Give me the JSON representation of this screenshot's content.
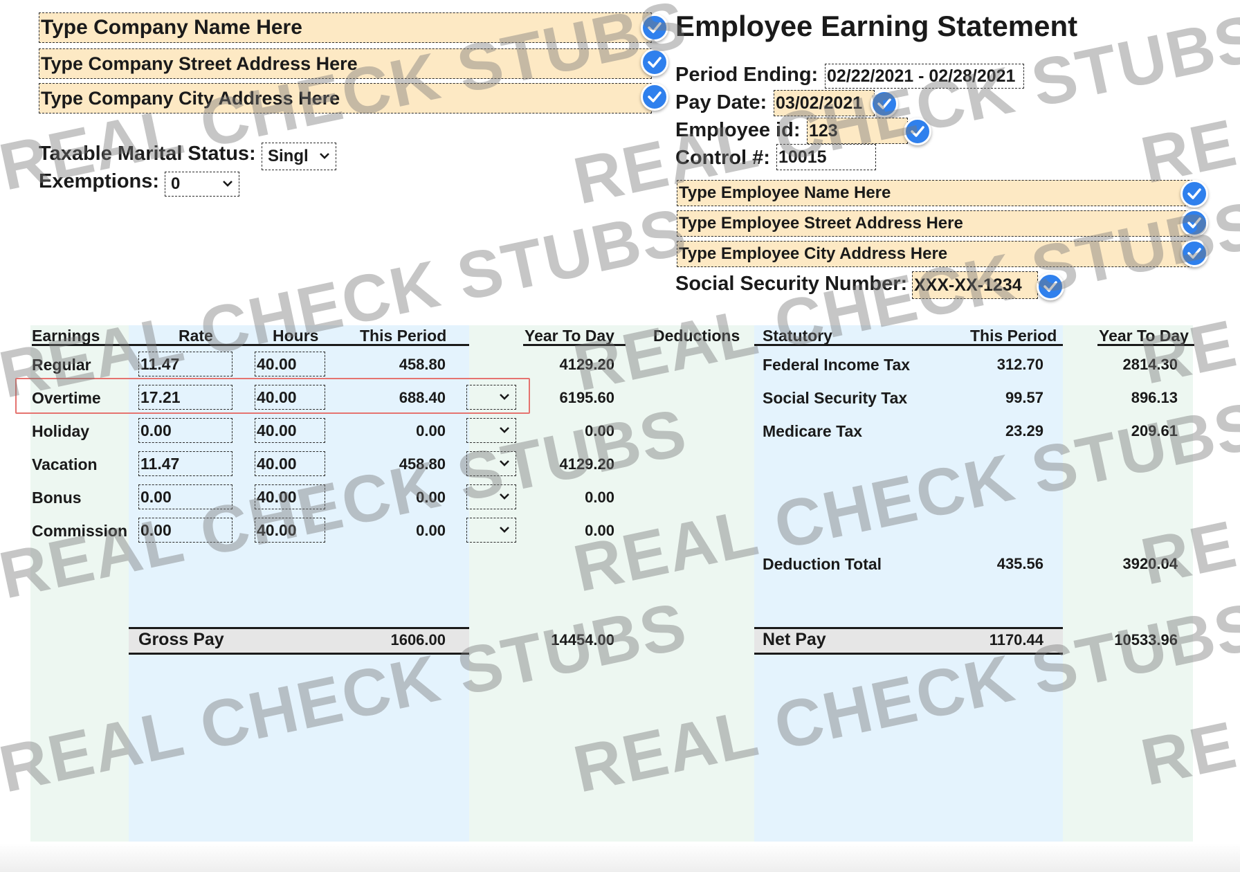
{
  "company": {
    "name": "Type Company Name Here",
    "street": "Type Company Street Address Here",
    "city": "Type Company City Address Here"
  },
  "statement": {
    "title": "Employee Earning Statement",
    "period_ending_label": "Period Ending:",
    "period_ending_value": "02/22/2021 - 02/28/2021",
    "pay_date_label": "Pay Date:",
    "pay_date_value": "03/02/2021",
    "employee_id_label": "Employee id:",
    "employee_id_value": "123",
    "control_label": "Control #:",
    "control_value": "10015"
  },
  "tax_settings": {
    "marital_label": "Taxable Marital Status:",
    "marital_value": "Singl",
    "exemptions_label": "Exemptions:",
    "exemptions_value": "0"
  },
  "employee": {
    "name": "Type Employee Name Here",
    "street": "Type Employee Street Address Here",
    "city": "Type Employee City Address Here",
    "ssn_label": "Social Security Number:",
    "ssn_value": "XXX-XX-1234"
  },
  "earnings": {
    "headers": {
      "earnings": "Earnings",
      "rate": "Rate",
      "hours": "Hours",
      "this_period": "This Period",
      "ytd": "Year To Day"
    },
    "rows": [
      {
        "label": "Regular",
        "rate": "11.47",
        "hours": "40.00",
        "period": "458.80",
        "ytd": "4129.20"
      },
      {
        "label": "Overtime",
        "rate": "17.21",
        "hours": "40.00",
        "period": "688.40",
        "ytd": "6195.60"
      },
      {
        "label": "Holiday",
        "rate": "0.00",
        "hours": "40.00",
        "period": "0.00",
        "ytd": "0.00"
      },
      {
        "label": "Vacation",
        "rate": "11.47",
        "hours": "40.00",
        "period": "458.80",
        "ytd": "4129.20"
      },
      {
        "label": "Bonus",
        "rate": "0.00",
        "hours": "40.00",
        "period": "0.00",
        "ytd": "0.00"
      },
      {
        "label": "Commission",
        "rate": "0.00",
        "hours": "40.00",
        "period": "0.00",
        "ytd": "0.00"
      }
    ],
    "gross_label": "Gross Pay",
    "gross_period": "1606.00",
    "gross_ytd": "14454.00"
  },
  "deductions": {
    "headers": {
      "deductions": "Deductions",
      "statutory": "Statutory",
      "this_period": "This Period",
      "ytd": "Year To Day"
    },
    "rows": [
      {
        "label": "Federal Income Tax",
        "period": "312.70",
        "ytd": "2814.30"
      },
      {
        "label": "Social Security Tax",
        "period": "99.57",
        "ytd": "896.13"
      },
      {
        "label": "Medicare Tax",
        "period": "23.29",
        "ytd": "209.61"
      }
    ],
    "total_label": "Deduction Total",
    "total_period": "435.56",
    "total_ytd": "3920.04",
    "net_label": "Net Pay",
    "net_period": "1170.44",
    "net_ytd": "10533.96"
  },
  "watermark": {
    "text": "REAL CHECK STUBS"
  },
  "icons": {
    "check": "check-circle-icon",
    "dropdown": "chevron-down-icon"
  },
  "colors": {
    "field_yellow": "#fde9c4",
    "check_blue": "#2f80ed",
    "panel_green": "#edf7f1",
    "panel_blue": "#e4f3fd",
    "highlight_red": "#e5736f"
  }
}
